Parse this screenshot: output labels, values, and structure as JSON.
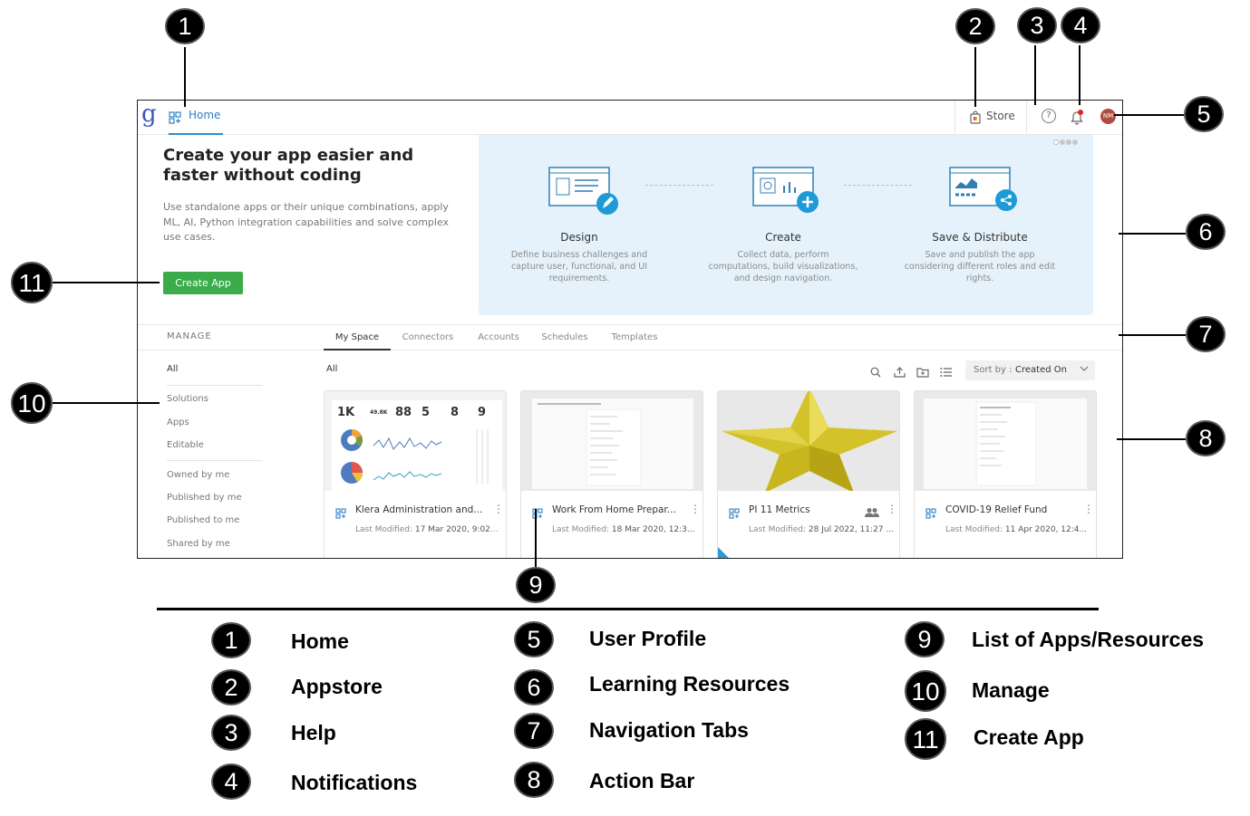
{
  "app": {
    "logo": "g",
    "home_label": "Home",
    "store_label": "Store",
    "help_glyph": "?",
    "avatar_initials": "NM"
  },
  "hero": {
    "title": "Create your app easier and faster without coding",
    "description": "Use standalone apps or their unique combinations, apply ML, AI, Python integration capabilities and solve complex use cases.",
    "create_button": "Create App"
  },
  "learning": {
    "steps": [
      {
        "title": "Design",
        "desc": "Define business challenges and capture user, functional, and UI requirements."
      },
      {
        "title": "Create",
        "desc": "Collect data, perform computations, build visualizations, and design navigation."
      },
      {
        "title": "Save & Distribute",
        "desc": "Save and publish the app considering different roles and edit rights."
      }
    ]
  },
  "nav": {
    "manage_label": "MANAGE",
    "tabs": [
      "My Space",
      "Connectors",
      "Accounts",
      "Schedules",
      "Templates"
    ]
  },
  "sidebar": {
    "items": [
      "All",
      "Solutions",
      "Apps",
      "Editable",
      "Owned by me",
      "Published by me",
      "Published to me",
      "Shared by me"
    ]
  },
  "actionbar": {
    "filter_label": "All",
    "sort_key": "Sort by :",
    "sort_value": "Created On"
  },
  "cards": [
    {
      "name": "Klera Administration and...",
      "meta_key": "Last Modified:",
      "meta_value": "17 Mar 2020, 9:02 ...",
      "kpis": [
        "1K",
        "49.8K",
        "88",
        "5",
        "8",
        "9"
      ]
    },
    {
      "name": "Work From Home Prepar...",
      "meta_key": "Last Modified:",
      "meta_value": "18 Mar 2020, 12:3..."
    },
    {
      "name": "PI 11 Metrics",
      "meta_key": "Last Modified:",
      "meta_value": "28 Jul 2022, 11:27 ..."
    },
    {
      "name": "COVID-19 Relief Fund",
      "meta_key": "Last Modified:",
      "meta_value": "11 Apr 2020, 12:4..."
    }
  ],
  "callouts": [
    "1",
    "2",
    "3",
    "4",
    "5",
    "6",
    "7",
    "8",
    "9",
    "10",
    "11"
  ],
  "legend": [
    {
      "num": "1",
      "label": "Home"
    },
    {
      "num": "2",
      "label": "Appstore"
    },
    {
      "num": "3",
      "label": "Help"
    },
    {
      "num": "4",
      "label": "Notifications"
    },
    {
      "num": "5",
      "label": "User Profile"
    },
    {
      "num": "6",
      "label": "Learning Resources"
    },
    {
      "num": "7",
      "label": "Navigation Tabs"
    },
    {
      "num": "8",
      "label": "Action Bar"
    },
    {
      "num": "9",
      "label": "List of Apps/Resources"
    },
    {
      "num": "10",
      "label": "Manage"
    },
    {
      "num": "11",
      "label": "Create App"
    }
  ],
  "colors": {
    "accent": "#2b8fd6",
    "create_button": "#3cab4a",
    "learning_bg": "#e6f2fb",
    "notification_dot": "#e02424"
  }
}
